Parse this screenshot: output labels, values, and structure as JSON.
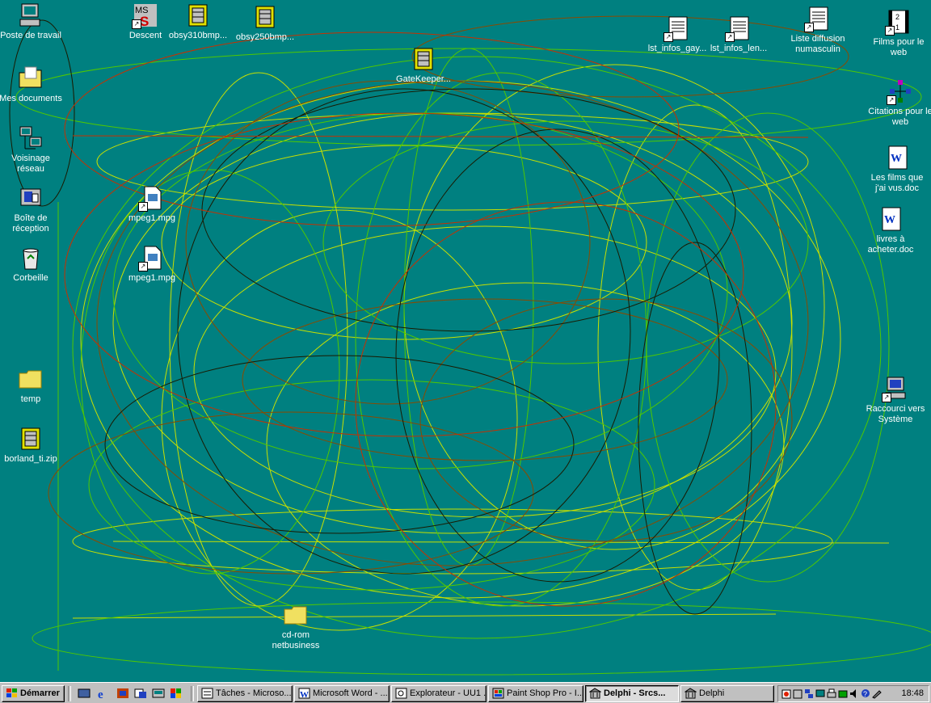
{
  "desktop": {
    "background_color": "#008080",
    "icons": {
      "poste_travail": "Poste de travail",
      "mes_documents": "Mes documents",
      "voisinage_reseau": "Voisinage réseau",
      "boite_reception": "Boîte de réception",
      "corbeille": "Corbeille",
      "temp": "temp",
      "borland": "borland_ti.zip",
      "descent": "Descent",
      "obsy310": "obsy310bmp...",
      "obsy250": "obsy250bmp...",
      "gatekeeper": "GateKeeper...",
      "mpeg1": "mpeg1.mpg",
      "mpeg2": "mpeg1.mpg",
      "lst_infos_gay": "lst_infos_gay...",
      "lst_infos_len": "lst_infos_len...",
      "liste_diffusion": "Liste diffusion numasculin",
      "films_web": "Films pour le web",
      "citations_web": "Citations pour le web",
      "films_vus": "Les films que j'ai vus.doc",
      "livres_acheter": "livres à acheter.doc",
      "raccourci_systeme": "Raccourci vers Système",
      "cd_rom": "cd-rom netbusiness"
    }
  },
  "taskbar": {
    "start_label": "Démarrer",
    "quick_launch": [
      "show-desktop-icon",
      "ie-icon",
      "outlook-icon",
      "channels-icon",
      "app-icon",
      "app2-icon"
    ],
    "tasks": {
      "taches": "Tâches - Microso...",
      "word": "Microsoft Word - ...",
      "explorateur": "Explorateur - UU1 ...",
      "paintshop": "Paint Shop Pro - I...",
      "delphi_srcs": "Delphi - Srcs...",
      "delphi": "Delphi"
    },
    "clock": "18:48"
  }
}
